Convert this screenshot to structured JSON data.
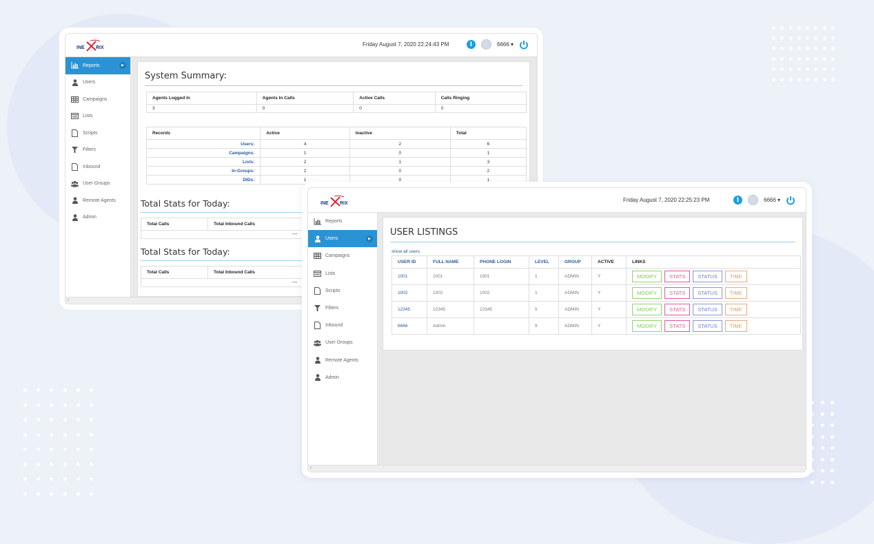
{
  "brand": {
    "logo_text": "INEXTRIX"
  },
  "window1": {
    "datetime": "Friday August 7, 2020 22:24:43 PM",
    "username": "6666",
    "sidebar": [
      {
        "label": "Reports",
        "icon": "bar-chart-icon",
        "active": true
      },
      {
        "label": "Users",
        "icon": "user-icon"
      },
      {
        "label": "Campaigns",
        "icon": "table-icon"
      },
      {
        "label": "Lists",
        "icon": "list-icon"
      },
      {
        "label": "Scripts",
        "icon": "file-icon"
      },
      {
        "label": "Filters",
        "icon": "filter-icon"
      },
      {
        "label": "Inbound",
        "icon": "file-icon"
      },
      {
        "label": "User Groups",
        "icon": "users-icon"
      },
      {
        "label": "Remote Agents",
        "icon": "user-icon"
      },
      {
        "label": "Admin",
        "icon": "user-icon"
      }
    ],
    "summary_title": "System Summary:",
    "summary_headers": [
      "Agents Logged In",
      "Agents In Calls",
      "Active Calls",
      "Calls Ringing"
    ],
    "summary_values": [
      "3",
      "0",
      "0",
      "0"
    ],
    "records_headers": [
      "Records",
      "Active",
      "Inactive",
      "Total"
    ],
    "records_rows": [
      [
        "Users:",
        "4",
        "2",
        "6"
      ],
      [
        "Campaigns:",
        "1",
        "0",
        "1"
      ],
      [
        "Lists:",
        "2",
        "1",
        "3"
      ],
      [
        "In-Groups:",
        "2",
        "0",
        "2"
      ],
      [
        "DIDs:",
        "1",
        "0",
        "1"
      ]
    ],
    "stats_title_1": "Total Stats for Today:",
    "stats_title_2": "Total Stats for Today:",
    "stats_headers": [
      "Total Calls",
      "Total Inbound Calls"
    ],
    "stats_ellipsis": "•••"
  },
  "window2": {
    "datetime": "Friday August 7, 2020 22:25:23 PM",
    "username": "6666",
    "sidebar": [
      {
        "label": "Reports",
        "icon": "bar-chart-icon"
      },
      {
        "label": "Users",
        "icon": "user-icon",
        "active": true
      },
      {
        "label": "Campaigns",
        "icon": "table-icon"
      },
      {
        "label": "Lists",
        "icon": "list-icon"
      },
      {
        "label": "Scripts",
        "icon": "file-icon"
      },
      {
        "label": "Filters",
        "icon": "filter-icon"
      },
      {
        "label": "Inbound",
        "icon": "file-icon"
      },
      {
        "label": "User Groups",
        "icon": "users-icon"
      },
      {
        "label": "Remote Agents",
        "icon": "user-icon"
      },
      {
        "label": "Admin",
        "icon": "user-icon"
      }
    ],
    "title": "USER LISTINGS",
    "show_all": "show all users",
    "headers": [
      "USER ID",
      "FULL NAME",
      "PHONE LOGIN",
      "LEVEL",
      "GROUP",
      "ACTIVE",
      "LINKS"
    ],
    "rows": [
      [
        "1001",
        "1001",
        "1001",
        "1",
        "ADMIN",
        "Y"
      ],
      [
        "1002",
        "1002",
        "1002",
        "1",
        "ADMIN",
        "Y"
      ],
      [
        "12345",
        "12345",
        "12345",
        "5",
        "ADMIN",
        "Y"
      ],
      [
        "6666",
        "Admin",
        "",
        "9",
        "ADMIN",
        "Y"
      ]
    ],
    "links": [
      "MODIFY",
      "STATS",
      "STATUS",
      "TIME"
    ]
  }
}
